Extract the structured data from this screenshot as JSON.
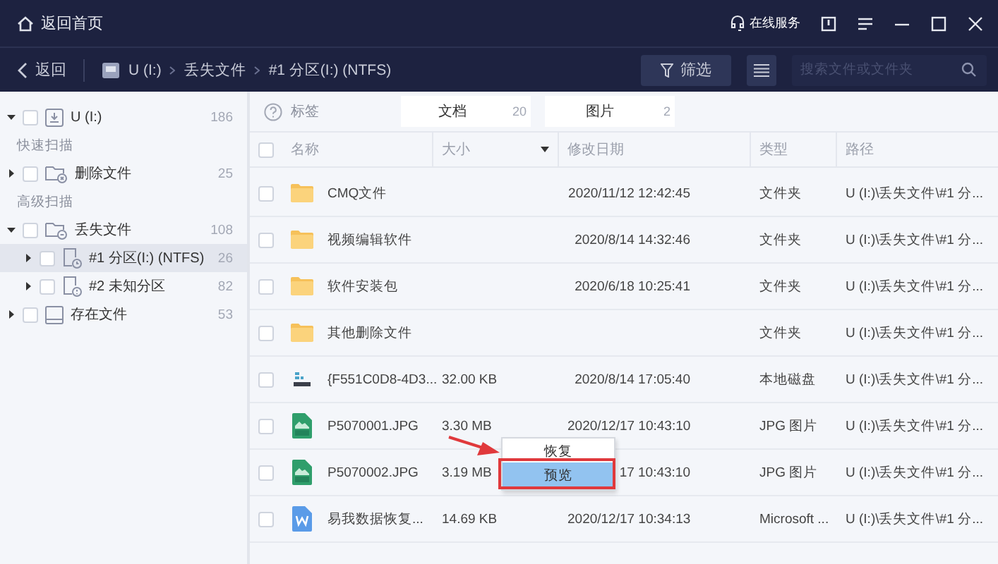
{
  "title_bar": {
    "home_label": "返回首页",
    "service_label": "在线服务"
  },
  "nav_bar": {
    "back_label": "返回",
    "breadcrumbs": [
      "U (I:)",
      "丢失文件",
      "#1 分区(I:) (NTFS)"
    ],
    "filter_label": "筛选",
    "search": {
      "placeholder": "搜索文件或文件夹"
    }
  },
  "sidebar": {
    "root": {
      "label": "U (I:)",
      "count": "186",
      "expanded": true,
      "checked": false
    },
    "sections": [
      {
        "heading": "快速扫描",
        "items": [
          {
            "kind": "deleted",
            "label": "删除文件",
            "count": "25",
            "expanded": false,
            "checked": false,
            "selected": false
          }
        ]
      },
      {
        "heading": "高级扫描",
        "items": [
          {
            "kind": "lost",
            "label": "丢失文件",
            "count": "108",
            "expanded": true,
            "checked": false,
            "selected": false,
            "children": [
              {
                "kind": "partition",
                "label": "#1 分区(I:) (NTFS)",
                "count": "26",
                "expanded": false,
                "checked": false,
                "selected": true
              },
              {
                "kind": "unknown",
                "label": "#2 未知分区",
                "count": "82",
                "expanded": false,
                "checked": false,
                "selected": false
              }
            ]
          },
          {
            "kind": "existing",
            "label": "存在文件",
            "count": "53",
            "expanded": false,
            "checked": false,
            "selected": false
          }
        ]
      }
    ]
  },
  "tags": {
    "label": "标签",
    "items": [
      {
        "label": "文档",
        "count": "20"
      },
      {
        "label": "图片",
        "count": "2"
      }
    ]
  },
  "table": {
    "all_checked": false,
    "columns": [
      "名称",
      "大小",
      "修改日期",
      "类型",
      "路径"
    ],
    "rows": [
      {
        "kind": "folder",
        "checked": false,
        "cells": [
          "CMQ文件",
          "",
          "2020/11/12 12:42:45",
          "文件夹",
          "U (I:)\\丢失文件\\#1 分..."
        ]
      },
      {
        "kind": "folder",
        "checked": false,
        "cells": [
          "视频编辑软件",
          "",
          "2020/8/14 14:32:46",
          "文件夹",
          "U (I:)\\丢失文件\\#1 分..."
        ]
      },
      {
        "kind": "folder",
        "checked": false,
        "cells": [
          "软件安装包",
          "",
          "2020/6/18 10:25:41",
          "文件夹",
          "U (I:)\\丢失文件\\#1 分..."
        ]
      },
      {
        "kind": "folder",
        "checked": false,
        "cells": [
          "其他删除文件",
          "",
          "",
          "文件夹",
          "U (I:)\\丢失文件\\#1 分..."
        ]
      },
      {
        "kind": "disk",
        "checked": false,
        "cells": [
          "{F551C0D8-4D3...",
          "32.00 KB",
          "2020/8/14 17:05:40",
          "本地磁盘",
          "U (I:)\\丢失文件\\#1 分..."
        ]
      },
      {
        "kind": "image",
        "checked": false,
        "cells": [
          "P5070001.JPG",
          "3.30 MB",
          "2020/12/17 10:43:10",
          "JPG 图片",
          "U (I:)\\丢失文件\\#1 分..."
        ]
      },
      {
        "kind": "image",
        "checked": false,
        "cells": [
          "P5070002.JPG",
          "3.19 MB",
          "17 10:43:10",
          "JPG 图片",
          "U (I:)\\丢失文件\\#1 分..."
        ]
      },
      {
        "kind": "word",
        "checked": false,
        "cells": [
          "易我数据恢复...",
          "14.69 KB",
          "2020/12/17 10:34:13",
          "Microsoft ...",
          "U (I:)\\丢失文件\\#1 分..."
        ]
      }
    ]
  },
  "context_menu": {
    "items": [
      {
        "label": "恢复",
        "selected": false
      },
      {
        "label": "预览",
        "selected": true
      }
    ]
  }
}
